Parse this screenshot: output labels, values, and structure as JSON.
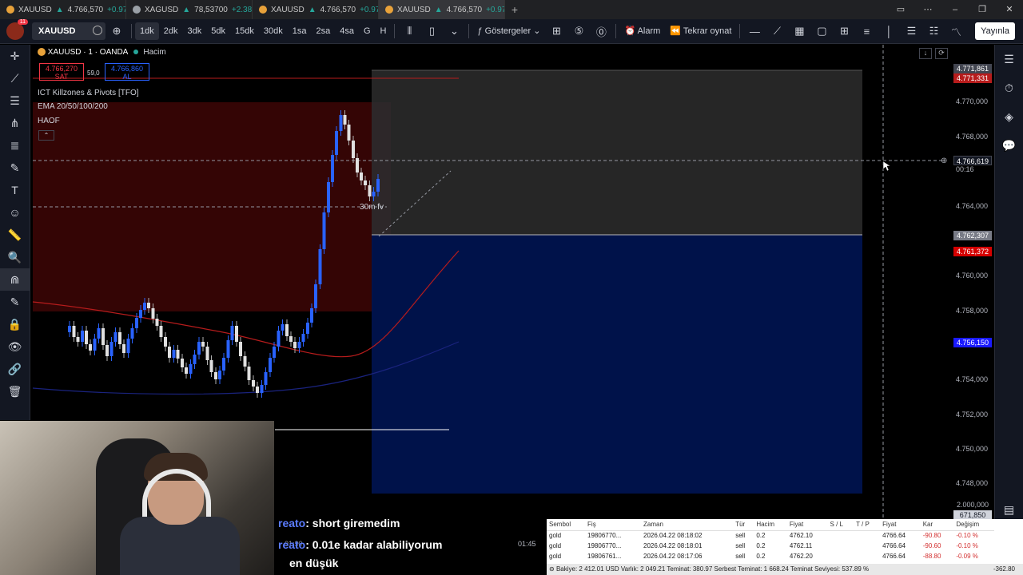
{
  "tabs": [
    {
      "symbol": "XAUUSD",
      "price": "4.766,570",
      "change": "+0.97%"
    },
    {
      "symbol": "XAGUSD",
      "price": "78,53700",
      "change": "+2.38%"
    },
    {
      "symbol": "XAUUSD",
      "price": "4.766,570",
      "change": "+0.97%"
    },
    {
      "symbol": "XAUUSD",
      "price": "4.766,570",
      "change": "+0.97%"
    }
  ],
  "toolbar": {
    "notif_count": "11",
    "symbol": "XAUUSD",
    "intervals": [
      "1dk",
      "2dk",
      "3dk",
      "5dk",
      "15dk",
      "30dk",
      "1sa",
      "2sa",
      "4sa",
      "G",
      "H"
    ],
    "indicators": "Göstergeler",
    "alarm": "Alarm",
    "replay": "Tekrar oynat",
    "publish": "Yayınla"
  },
  "legend": {
    "title": "XAUUSD · 1 · OANDA",
    "volume": "Hacim",
    "sell_price": "4.766,270",
    "sell_label": "SAT",
    "spread": "59,0",
    "buy_price": "4.766,860",
    "buy_label": "AL",
    "ind1": "ICT Killzones & Pivots [TFO]",
    "ind2": "EMA 20/50/100/200",
    "ind3": "HAOF",
    "fv_label": "30m fv"
  },
  "price_axis": {
    "ticks": [
      "4.770,000",
      "4.768,000",
      "4.764,000",
      "4.760,000",
      "4.758,000",
      "4.756,000",
      "4.754,000",
      "4.752,000",
      "4.750,000",
      "4.748,000"
    ],
    "tag_high": "4.771,861",
    "tag_red1": "4.771,331",
    "tag_current": "4.766,619",
    "tag_countdown": "00:16",
    "tag_grey": "4.762,307",
    "tag_red2": "4.761,372",
    "tag_blue": "4.756,150",
    "tag_bottom1": "2.000,000",
    "tag_bottom2": "671,850"
  },
  "time_axis": {
    "t1": "01:30",
    "t2": "01:45"
  },
  "chat": [
    {
      "user": "reato",
      "text": ": short giremedim"
    },
    {
      "user": "reato",
      "text": ": 0.01e kadar alabiliyorum"
    },
    {
      "user": "",
      "text": "en düşük"
    }
  ],
  "trades": {
    "headers": [
      "Sembol",
      "Fiş",
      "Zaman",
      "Tür",
      "Hacim",
      "Fiyat",
      "S / L",
      "T / P",
      "Fiyat",
      "Kar",
      "Değişim"
    ],
    "rows": [
      [
        "gold",
        "19806770...",
        "2026.04.22 08:18:02",
        "sell",
        "0.2",
        "4762.10",
        "",
        "",
        "4766.64",
        "-90.80",
        "-0.10 %"
      ],
      [
        "gold",
        "19806770...",
        "2026.04.22 08:18:01",
        "sell",
        "0.2",
        "4762.11",
        "",
        "",
        "4766.64",
        "-90.60",
        "-0.10 %"
      ],
      [
        "gold",
        "19806761...",
        "2026.04.22 08:17:06",
        "sell",
        "0.2",
        "4762.20",
        "",
        "",
        "4766.64",
        "-88.80",
        "-0.09 %"
      ]
    ],
    "footer": "Bakiye: 2 412.01 USD  Varlık: 2 049.21  Teminat: 380.97  Serbest Teminat: 1 668.24  Teminat Seviyesi: 537.89 %",
    "total": "-362.80"
  }
}
